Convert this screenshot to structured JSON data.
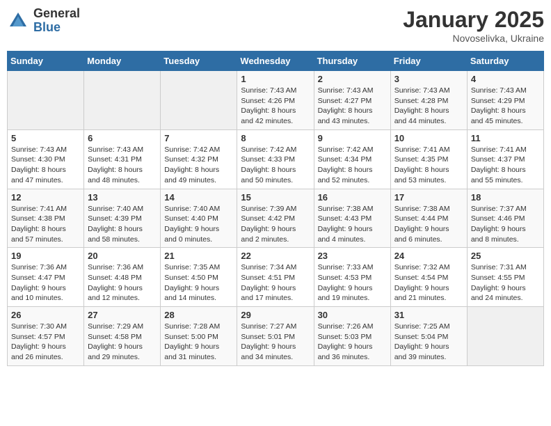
{
  "logo": {
    "general": "General",
    "blue": "Blue"
  },
  "title": "January 2025",
  "subtitle": "Novoselivka, Ukraine",
  "days_of_week": [
    "Sunday",
    "Monday",
    "Tuesday",
    "Wednesday",
    "Thursday",
    "Friday",
    "Saturday"
  ],
  "weeks": [
    [
      {
        "num": "",
        "info": ""
      },
      {
        "num": "",
        "info": ""
      },
      {
        "num": "",
        "info": ""
      },
      {
        "num": "1",
        "info": "Sunrise: 7:43 AM\nSunset: 4:26 PM\nDaylight: 8 hours and 42 minutes."
      },
      {
        "num": "2",
        "info": "Sunrise: 7:43 AM\nSunset: 4:27 PM\nDaylight: 8 hours and 43 minutes."
      },
      {
        "num": "3",
        "info": "Sunrise: 7:43 AM\nSunset: 4:28 PM\nDaylight: 8 hours and 44 minutes."
      },
      {
        "num": "4",
        "info": "Sunrise: 7:43 AM\nSunset: 4:29 PM\nDaylight: 8 hours and 45 minutes."
      }
    ],
    [
      {
        "num": "5",
        "info": "Sunrise: 7:43 AM\nSunset: 4:30 PM\nDaylight: 8 hours and 47 minutes."
      },
      {
        "num": "6",
        "info": "Sunrise: 7:43 AM\nSunset: 4:31 PM\nDaylight: 8 hours and 48 minutes."
      },
      {
        "num": "7",
        "info": "Sunrise: 7:42 AM\nSunset: 4:32 PM\nDaylight: 8 hours and 49 minutes."
      },
      {
        "num": "8",
        "info": "Sunrise: 7:42 AM\nSunset: 4:33 PM\nDaylight: 8 hours and 50 minutes."
      },
      {
        "num": "9",
        "info": "Sunrise: 7:42 AM\nSunset: 4:34 PM\nDaylight: 8 hours and 52 minutes."
      },
      {
        "num": "10",
        "info": "Sunrise: 7:41 AM\nSunset: 4:35 PM\nDaylight: 8 hours and 53 minutes."
      },
      {
        "num": "11",
        "info": "Sunrise: 7:41 AM\nSunset: 4:37 PM\nDaylight: 8 hours and 55 minutes."
      }
    ],
    [
      {
        "num": "12",
        "info": "Sunrise: 7:41 AM\nSunset: 4:38 PM\nDaylight: 8 hours and 57 minutes."
      },
      {
        "num": "13",
        "info": "Sunrise: 7:40 AM\nSunset: 4:39 PM\nDaylight: 8 hours and 58 minutes."
      },
      {
        "num": "14",
        "info": "Sunrise: 7:40 AM\nSunset: 4:40 PM\nDaylight: 9 hours and 0 minutes."
      },
      {
        "num": "15",
        "info": "Sunrise: 7:39 AM\nSunset: 4:42 PM\nDaylight: 9 hours and 2 minutes."
      },
      {
        "num": "16",
        "info": "Sunrise: 7:38 AM\nSunset: 4:43 PM\nDaylight: 9 hours and 4 minutes."
      },
      {
        "num": "17",
        "info": "Sunrise: 7:38 AM\nSunset: 4:44 PM\nDaylight: 9 hours and 6 minutes."
      },
      {
        "num": "18",
        "info": "Sunrise: 7:37 AM\nSunset: 4:46 PM\nDaylight: 9 hours and 8 minutes."
      }
    ],
    [
      {
        "num": "19",
        "info": "Sunrise: 7:36 AM\nSunset: 4:47 PM\nDaylight: 9 hours and 10 minutes."
      },
      {
        "num": "20",
        "info": "Sunrise: 7:36 AM\nSunset: 4:48 PM\nDaylight: 9 hours and 12 minutes."
      },
      {
        "num": "21",
        "info": "Sunrise: 7:35 AM\nSunset: 4:50 PM\nDaylight: 9 hours and 14 minutes."
      },
      {
        "num": "22",
        "info": "Sunrise: 7:34 AM\nSunset: 4:51 PM\nDaylight: 9 hours and 17 minutes."
      },
      {
        "num": "23",
        "info": "Sunrise: 7:33 AM\nSunset: 4:53 PM\nDaylight: 9 hours and 19 minutes."
      },
      {
        "num": "24",
        "info": "Sunrise: 7:32 AM\nSunset: 4:54 PM\nDaylight: 9 hours and 21 minutes."
      },
      {
        "num": "25",
        "info": "Sunrise: 7:31 AM\nSunset: 4:55 PM\nDaylight: 9 hours and 24 minutes."
      }
    ],
    [
      {
        "num": "26",
        "info": "Sunrise: 7:30 AM\nSunset: 4:57 PM\nDaylight: 9 hours and 26 minutes."
      },
      {
        "num": "27",
        "info": "Sunrise: 7:29 AM\nSunset: 4:58 PM\nDaylight: 9 hours and 29 minutes."
      },
      {
        "num": "28",
        "info": "Sunrise: 7:28 AM\nSunset: 5:00 PM\nDaylight: 9 hours and 31 minutes."
      },
      {
        "num": "29",
        "info": "Sunrise: 7:27 AM\nSunset: 5:01 PM\nDaylight: 9 hours and 34 minutes."
      },
      {
        "num": "30",
        "info": "Sunrise: 7:26 AM\nSunset: 5:03 PM\nDaylight: 9 hours and 36 minutes."
      },
      {
        "num": "31",
        "info": "Sunrise: 7:25 AM\nSunset: 5:04 PM\nDaylight: 9 hours and 39 minutes."
      },
      {
        "num": "",
        "info": ""
      }
    ]
  ]
}
